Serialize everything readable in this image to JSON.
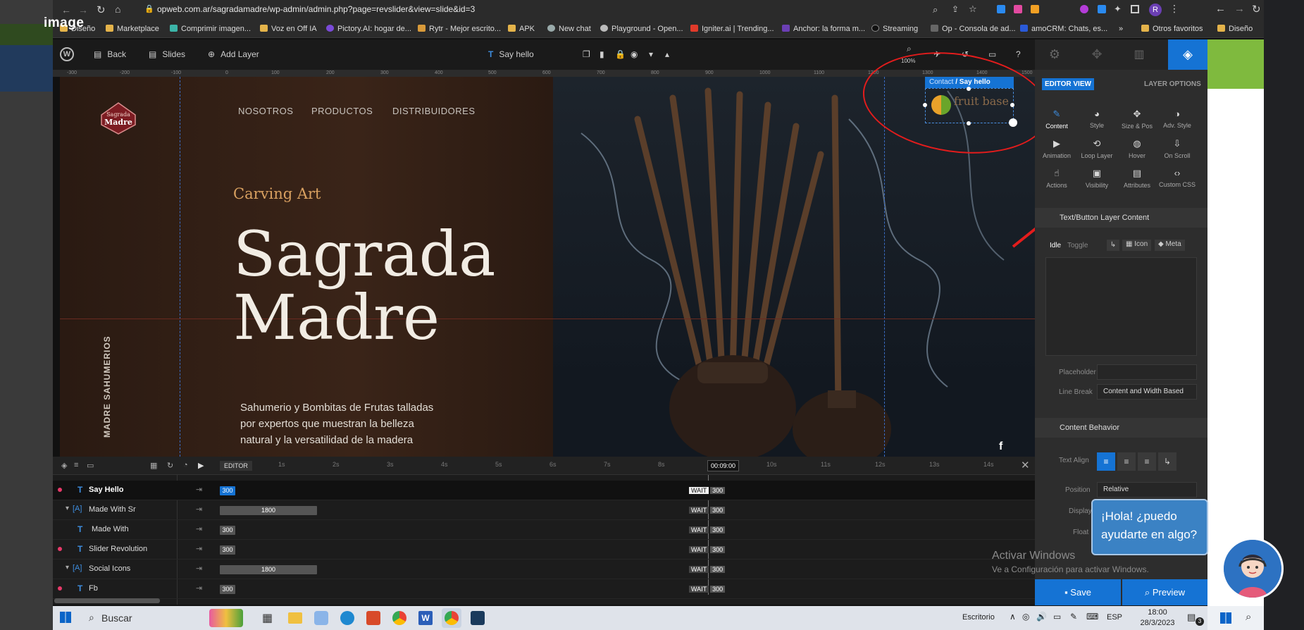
{
  "watermark_label": "image",
  "browser": {
    "url": "opweb.com.ar/sagradamadre/wp-admin/admin.php?page=revslider&view=slide&id=3",
    "bookmarks": [
      "Diseño",
      "Marketplace",
      "Comprimir imagen...",
      "Voz en Off IA",
      "Pictory.AI: hogar de...",
      "Rytr - Mejor escrito...",
      "APK",
      "New chat",
      "Playground - Open...",
      "Igniter.ai | Trending...",
      "Anchor: la forma m...",
      "Streaming",
      "Op - Consola de ad...",
      "amoCRM: Chats, es...",
      "»",
      "Otros favoritos",
      "Diseño"
    ],
    "profile_initial": "R"
  },
  "toolbar": {
    "back": "Back",
    "slides": "Slides",
    "add_layer": "Add Layer",
    "current_layer": "Say hello",
    "zoom": "100%"
  },
  "ruler_ticks": [
    "-300",
    "-200",
    "-100",
    "0",
    "100",
    "200",
    "300",
    "400",
    "500",
    "600",
    "700",
    "800",
    "900",
    "1000",
    "1100",
    "1200",
    "1300",
    "1400",
    "1500"
  ],
  "canvas": {
    "logo_line1": "Sagrada",
    "logo_line2": "Madre",
    "nav": [
      "NOSOTROS",
      "PRODUCTOS",
      "DISTRIBUIDORES"
    ],
    "tagline": "Carving Art",
    "hero_line1": "Sagrada",
    "hero_line2": "Madre",
    "description": "Sahumerio y Bombitas de Frutas talladas por expertos que muestran la belleza natural y la versatilidad de la madera",
    "vertical_text": "MADRE SAHUMERIOS",
    "selected_label_a": "Contact",
    "selected_label_b": " / Say hello",
    "selected_image_text": "fruit base",
    "social_icon": "f"
  },
  "panel": {
    "editor_view": "EDITOR VIEW",
    "layer_options": "LAYER OPTIONS",
    "tabs_row1": [
      "Content",
      "Style",
      "Size & Pos",
      "Adv. Style"
    ],
    "tabs_row2": [
      "Animation",
      "Loop Layer",
      "Hover",
      "On Scroll"
    ],
    "tabs_row3": [
      "Actions",
      "Visibility",
      "Attributes",
      "Custom CSS"
    ],
    "section_content": "Text/Button Layer Content",
    "idle": "Idle",
    "toggle": "Toggle",
    "icon": "Icon",
    "meta": "Meta",
    "placeholder_label": "Placeholder",
    "line_break_label": "Line Break",
    "line_break_value": "Content and Width Based",
    "section_behavior": "Content Behavior",
    "text_align_label": "Text Align",
    "position_label": "Position",
    "position_value": "Relative",
    "display_label": "Display",
    "float_label": "Float",
    "save": "Save",
    "preview": "Preview"
  },
  "timeline": {
    "editor_tag": "EDITOR",
    "time_marks": [
      "1s",
      "2s",
      "3s",
      "4s",
      "5s",
      "6s",
      "7s",
      "8s",
      "",
      "10s",
      "11s",
      "12s",
      "13s",
      "14s"
    ],
    "current_time": "00:09:00",
    "wait_label": "WAIT",
    "rows": [
      {
        "name": "Say Hello",
        "dot": true,
        "group": false,
        "bar": "300",
        "wait": "300"
      },
      {
        "name": "Made With Sr",
        "dot": false,
        "group": true,
        "bar": "1800",
        "wait": "300"
      },
      {
        "name": "Made With",
        "dot": false,
        "group": false,
        "bar": "300",
        "wait": "300"
      },
      {
        "name": "Slider Revolution",
        "dot": true,
        "group": false,
        "bar": "300",
        "wait": "300"
      },
      {
        "name": "Social Icons",
        "dot": false,
        "group": true,
        "bar": "1800",
        "wait": "300"
      },
      {
        "name": "Fb",
        "dot": true,
        "group": false,
        "bar": "300",
        "wait": "300"
      }
    ]
  },
  "chat": {
    "message": "¡Hola! ¿puedo ayudarte en algo?"
  },
  "windows_watermark": {
    "line1": "Activar Windows",
    "line2": "Ve a Configuración para activar Windows."
  },
  "taskbar": {
    "search": "Buscar",
    "desktop": "Escritorio",
    "lang": "ESP",
    "time": "18:00",
    "date": "28/3/2023",
    "notif_count": "3"
  },
  "colors": {
    "accent": "#1573d4",
    "annotation": "#e31c1c",
    "chat": "#3b82c4"
  }
}
